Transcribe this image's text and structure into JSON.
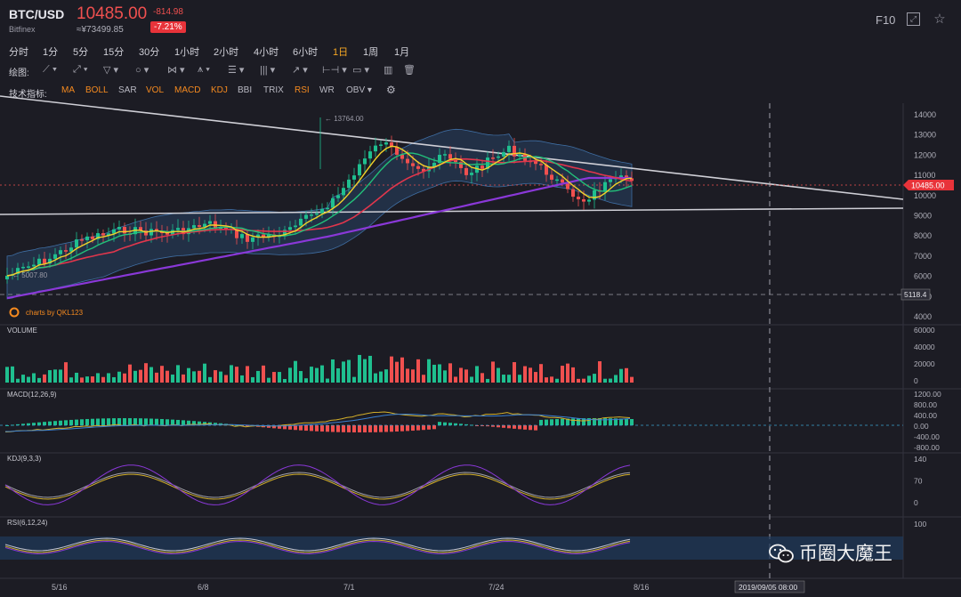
{
  "header": {
    "symbol": "BTC/USD",
    "exchange": "Bitfinex",
    "price": "10485.00",
    "cny_price": "≈¥73499.85",
    "change": "-814.98",
    "change_pct": "-7.21%",
    "f10_label": "F10"
  },
  "timeframes": [
    {
      "label": "分时"
    },
    {
      "label": "1分"
    },
    {
      "label": "5分"
    },
    {
      "label": "15分"
    },
    {
      "label": "30分"
    },
    {
      "label": "1小时"
    },
    {
      "label": "2小时"
    },
    {
      "label": "4小时"
    },
    {
      "label": "6小时"
    },
    {
      "label": "1日",
      "active": true
    },
    {
      "label": "1周"
    },
    {
      "label": "1月"
    }
  ],
  "drawing": {
    "label": "绘图:"
  },
  "indicators": {
    "label": "技术指标:",
    "items": [
      {
        "label": "MA",
        "active": true
      },
      {
        "label": "BOLL",
        "active": true
      },
      {
        "label": "SAR",
        "active": false
      },
      {
        "label": "VOL",
        "active": true
      },
      {
        "label": "MACD",
        "active": true
      },
      {
        "label": "KDJ",
        "active": true
      },
      {
        "label": "BBI",
        "active": false
      },
      {
        "label": "TRIX",
        "active": false
      },
      {
        "label": "RSI",
        "active": true
      },
      {
        "label": "WR",
        "active": false
      },
      {
        "label": "OBV ▾",
        "active": false
      }
    ]
  },
  "main_chart": {
    "y_ticks": [
      "14000",
      "13000",
      "12000",
      "11000",
      "10000",
      "9000",
      "8000",
      "7000",
      "6000",
      "5000",
      "4000"
    ],
    "high_label": "← 13764.00",
    "low_label": "← 5007.80",
    "price_tag": "10485.00",
    "crosshair_tag": "5118.4",
    "credit": "charts by QKL123"
  },
  "volume": {
    "title": "VOLUME",
    "y_ticks": [
      "60000",
      "40000",
      "20000",
      "0"
    ]
  },
  "macd": {
    "title": "MACD(12,26,9)",
    "y_ticks": [
      "1200.00",
      "800.00",
      "400.00",
      "0.00",
      "-400.00",
      "-800.00"
    ]
  },
  "kdj": {
    "title": "KDJ(9,3,3)",
    "y_ticks": [
      "140",
      "70",
      "0"
    ]
  },
  "rsi": {
    "title": "RSI(6,12,24)",
    "y_ticks": [
      "100"
    ]
  },
  "x_axis": {
    "labels": [
      "5/16",
      "6/8",
      "7/1",
      "7/24",
      "8/16"
    ],
    "crosshair_time": "2019/09/05 08:00"
  },
  "watermark": "币圈大魔王",
  "colors": {
    "up": "#1fbf8f",
    "down": "#f0504f",
    "accent": "#f58a1f",
    "bg": "#1c1c24"
  }
}
